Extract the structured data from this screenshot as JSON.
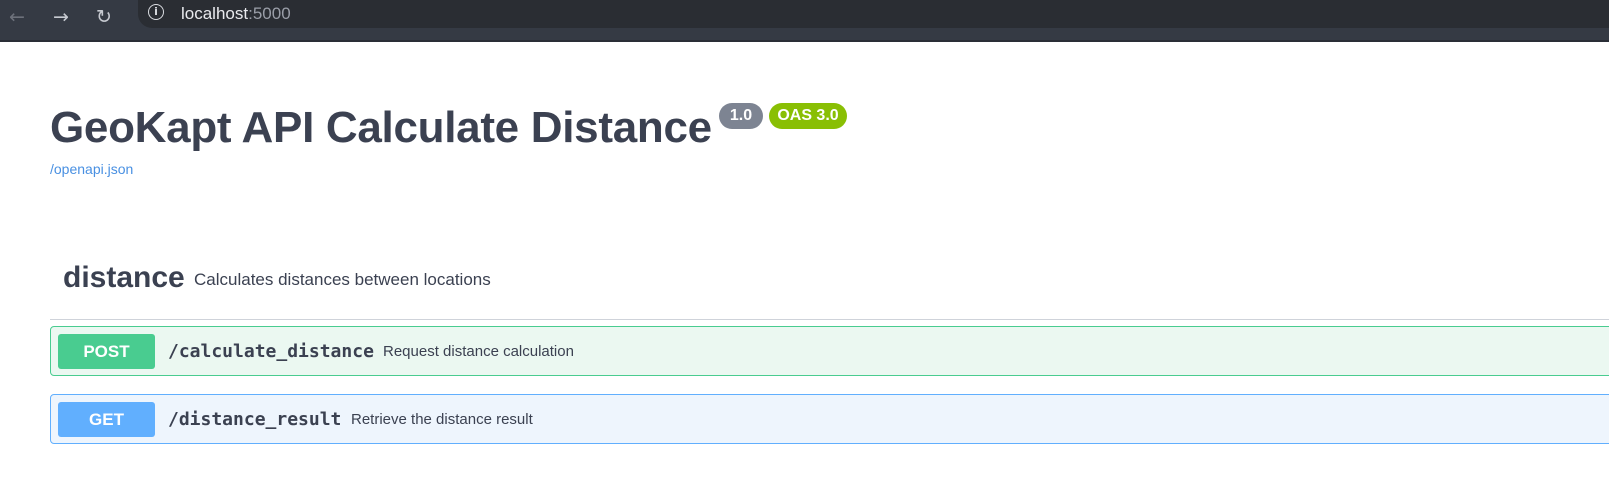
{
  "browser": {
    "back_icon": "←",
    "forward_icon": "→",
    "reload_icon": "↻",
    "info_icon": "i",
    "url_host": "localhost",
    "url_port": ":5000"
  },
  "api": {
    "title": "GeoKapt API Calculate Distance",
    "version": "1.0",
    "oas": "OAS 3.0",
    "spec_link": "/openapi.json"
  },
  "tag": {
    "name": "distance",
    "description": "Calculates distances between locations"
  },
  "operations": [
    {
      "method": "POST",
      "path": "/calculate_distance",
      "summary": "Request distance calculation",
      "color": "#49cc90"
    },
    {
      "method": "GET",
      "path": "/distance_result",
      "summary": "Retrieve the distance result",
      "color": "#61affe"
    }
  ]
}
